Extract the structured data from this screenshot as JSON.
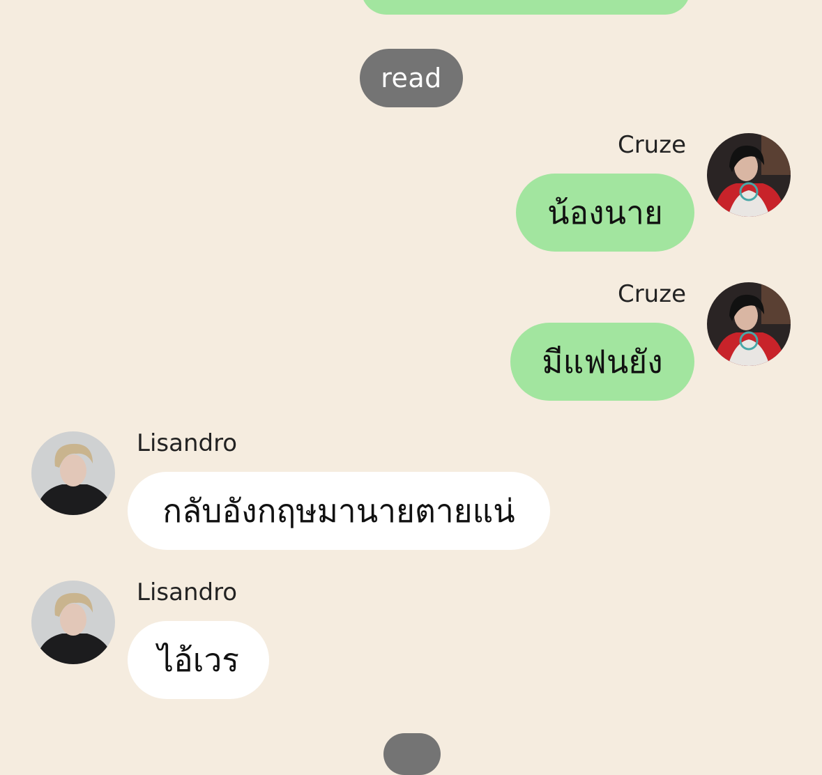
{
  "status": {
    "read_label": "read"
  },
  "messages": [
    {
      "sender": "Cruze",
      "text": "น้องนาย",
      "direction": "outgoing",
      "avatar": "cruze-avatar"
    },
    {
      "sender": "Cruze",
      "text": "มีแฟนยัง",
      "direction": "outgoing",
      "avatar": "cruze-avatar"
    },
    {
      "sender": "Lisandro",
      "text": "กลับอังกฤษมานายตายแน่",
      "direction": "incoming",
      "avatar": "lisandro-avatar"
    },
    {
      "sender": "Lisandro",
      "text": "ไอ้เวร",
      "direction": "incoming",
      "avatar": "lisandro-avatar"
    }
  ],
  "colors": {
    "background": "#f5ecdf",
    "outgoing_bubble": "#a2e59f",
    "incoming_bubble": "#ffffff",
    "read_pill": "#747474"
  }
}
